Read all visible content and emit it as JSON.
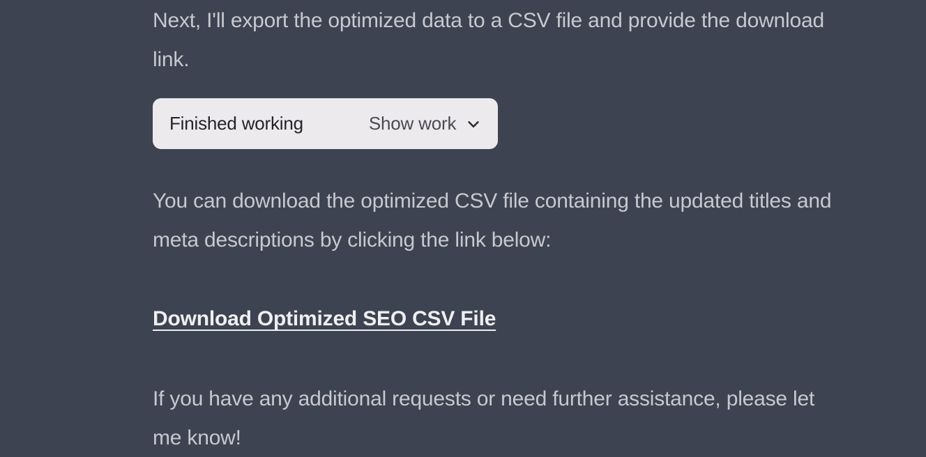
{
  "message": {
    "intro": "Next, I'll export the optimized data to a CSV file and provide the download link.",
    "status_label": "Finished working",
    "show_work_label": "Show work",
    "body": "You can download the optimized CSV file containing the updated titles and meta descriptions by clicking the link below:",
    "download_link_text": "Download Optimized SEO CSV File",
    "closing": "If you have any additional requests or need further assistance, please let me know!"
  },
  "icons": {
    "chevron_down": "chevron-down-icon"
  },
  "colors": {
    "background": "#3d4351",
    "text": "#c7c9cf",
    "pill_bg": "#eceaed",
    "pill_text_primary": "#23242a",
    "pill_text_secondary": "#4a4b52",
    "link_text": "#efeff1"
  }
}
